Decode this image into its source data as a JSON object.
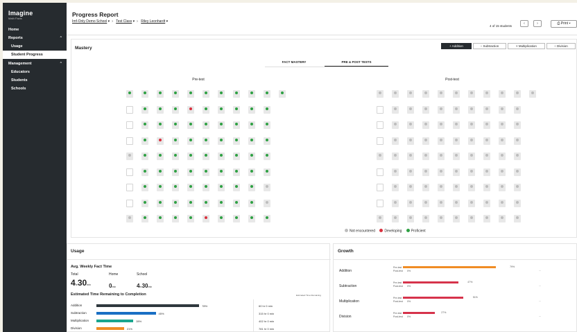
{
  "sidebar": {
    "brand": "Imagine",
    "brand_sub": "Math Facts",
    "items": [
      {
        "label": "Home"
      },
      {
        "label": "Reports"
      },
      {
        "label": "Usage"
      },
      {
        "label": "Student Progress"
      },
      {
        "label": "Management"
      },
      {
        "label": "Educators"
      },
      {
        "label": "Students"
      },
      {
        "label": "Schools"
      }
    ]
  },
  "header": {
    "title": "Progress Report",
    "crumbs": [
      "Imf-Only Demo School",
      "Test Class",
      "Riley Leonhardt"
    ],
    "student_count": "4 of 15 students",
    "print_label": "Print"
  },
  "mastery": {
    "heading": "Mastery",
    "operations": [
      "+ Addition",
      "− Subtraction",
      "× Multiplication",
      "÷ Division"
    ],
    "tabs": [
      "FACT MASTERY",
      "PRE & POST TESTS"
    ],
    "pre_label": "Pre-test",
    "post_label": "Post-test",
    "legend": [
      "Not encountered",
      "Developing",
      "Proficient"
    ],
    "pre_grid": [
      "PPPPPPPPPPP",
      "EPPPRPPPPP",
      "EPPPPPPPPP",
      "EPRPPPPPPP",
      "NPPPPPPPPP",
      "EPPPPPPPPP",
      "EPPPPPPPPN",
      "EPPPPPPPPN",
      "NPPPPRPPPP"
    ],
    "post_grid": [
      "NNNNNNNNNNN",
      "ENNNNNNNNN",
      "ENNNNNNNNN",
      "ENNNNNNNNN",
      "NNNNNNNNNN",
      "ENNNNNNNNN",
      "ENNNNNNNNN",
      "ENNNNNNNNN",
      "NNNNNNNNNN"
    ]
  },
  "usage": {
    "heading": "Usage",
    "avg_title": "Avg. Weekly Fact Time",
    "cols": [
      {
        "label": "Total",
        "value": "4",
        "unit1": "hr",
        "value2": "30",
        "unit2": "min"
      },
      {
        "label": "Home",
        "value": "0",
        "unit1": "min"
      },
      {
        "label": "School",
        "value": "4",
        "unit1": "hr",
        "value2": "30",
        "unit2": "min"
      }
    ],
    "est_title": "Estimated Time Remaining to Completion",
    "est_col": "Estimated Time Remaining",
    "rows": [
      {
        "label": "Addition",
        "percent": "78%",
        "value": 78,
        "color": "#2f383e",
        "time": "60 hr 0 min"
      },
      {
        "label": "Subtraction",
        "percent": "45%",
        "value": 45,
        "color": "#1a6fc4",
        "time": "315 hr 0 min"
      },
      {
        "label": "Multiplication",
        "percent": "28%",
        "value": 28,
        "color": "#1aa68f",
        "time": "402 hr 0 min"
      },
      {
        "label": "Division",
        "percent": "21%",
        "value": 21,
        "color": "#f08c24",
        "time": "781 hr 0 min"
      }
    ]
  },
  "growth": {
    "heading": "Growth",
    "pre": "Pre-test",
    "post": "Post-test",
    "rows": [
      {
        "label": "Addition",
        "percent": "79%",
        "value": 79,
        "color": "#f08c24",
        "post": "0%"
      },
      {
        "label": "Subtraction",
        "percent": "47%",
        "value": 47,
        "color": "#d6334b",
        "post": "0%"
      },
      {
        "label": "Multiplication",
        "percent": "51%",
        "value": 51,
        "color": "#d6334b",
        "post": "0%"
      },
      {
        "label": "Division",
        "percent": "27%",
        "value": 27,
        "color": "#d6334b",
        "post": "0%"
      }
    ],
    "more": "..."
  },
  "colors": {
    "proficient": "#2ea043",
    "developing": "#d9303e",
    "not_encountered": "#bdbdbd"
  }
}
